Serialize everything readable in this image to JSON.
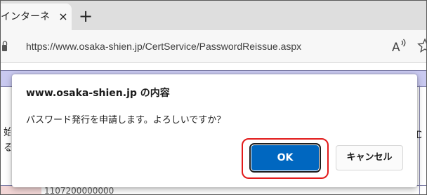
{
  "browser": {
    "tab": {
      "title": "インターネ",
      "close_glyph": "×"
    },
    "new_tab_glyph": "+",
    "address_bar": {
      "url": "https://www.osaka-shien.jp/CertService/PasswordReissue.aspx"
    },
    "icons": {
      "read_aloud": "read-aloud-icon",
      "favorite": "star-icon",
      "lock": "lock-icon"
    }
  },
  "background_page": {
    "left_text": "始る",
    "right_text": "ID",
    "bottom_number": "1107200000000"
  },
  "dialog": {
    "title": "www.osaka-shien.jp の内容",
    "message": "パスワード発行を申請します。よろしいですか？",
    "ok_label": "OK",
    "cancel_label": "キャンセル"
  },
  "colors": {
    "ok_button": "#0067c0",
    "highlight_ring": "#e21a1a",
    "page_band": "#c9c9f0"
  }
}
